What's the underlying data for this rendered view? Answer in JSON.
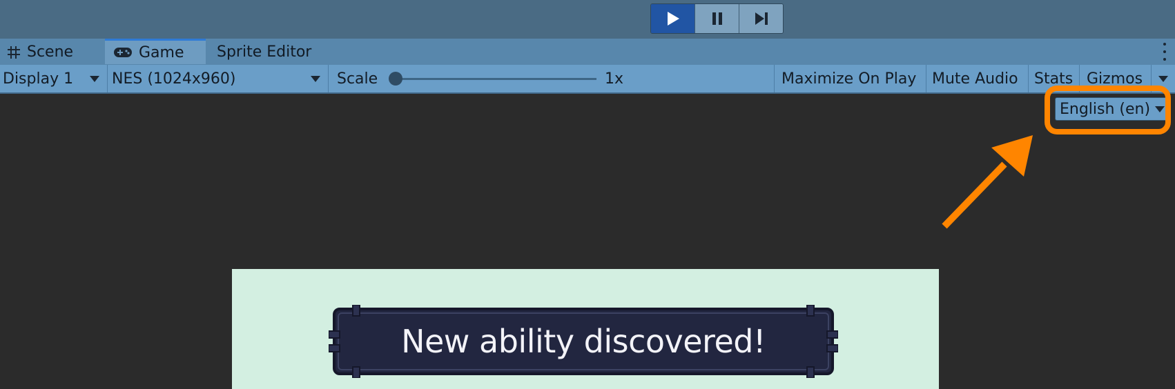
{
  "playbar": {
    "buttons": [
      {
        "icon": "play-icon",
        "active": true
      },
      {
        "icon": "pause-icon",
        "active": false
      },
      {
        "icon": "step-icon",
        "active": false
      }
    ]
  },
  "tabs": [
    {
      "label": "Scene",
      "icon": "grid-icon",
      "active": false
    },
    {
      "label": "Game",
      "icon": "gamepad-icon",
      "active": true
    },
    {
      "label": "Sprite Editor",
      "icon": "",
      "active": false
    }
  ],
  "toolbar": {
    "display": "Display 1",
    "resolution": "NES (1024x960)",
    "scale_label": "Scale",
    "scale_value": "1x",
    "maximize_on_play": "Maximize On Play",
    "mute_audio": "Mute Audio",
    "stats": "Stats",
    "gizmos": "Gizmos"
  },
  "game_view": {
    "language": "English (en)",
    "banner_text": "New ability discovered!"
  },
  "colors": {
    "highlight": "#ff8500",
    "active_play": "#2155a4",
    "game_background": "#d3efe1",
    "banner": "#222640"
  }
}
